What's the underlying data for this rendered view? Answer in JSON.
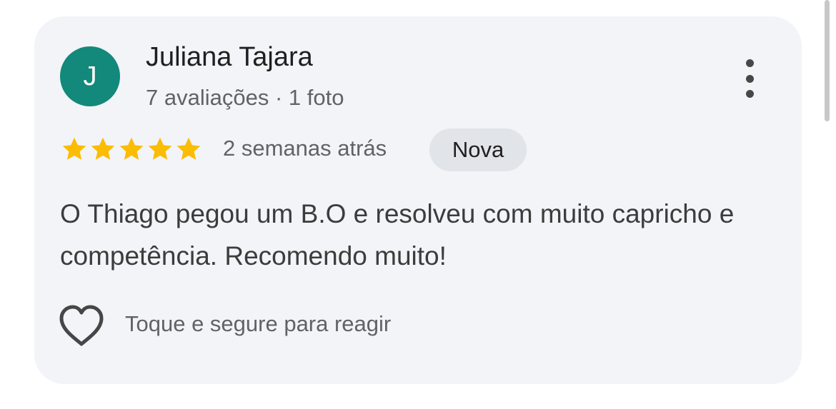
{
  "review": {
    "author_initial": "J",
    "author_name": "Juliana Tajara",
    "author_meta": "7 avaliações · 1 foto",
    "rating": 5,
    "rating_max": 5,
    "time_ago": "2 semanas atrás",
    "badge": "Nova",
    "text": "O Thiago pegou um B.O e resolveu com muito capricho e competência. Recomendo muito!",
    "react_label": "Toque e segure para reagir"
  },
  "colors": {
    "card_background": "#f3f4f7",
    "avatar": "#12897a",
    "star": "#fbbc04",
    "badge_background": "#e1e4e8"
  },
  "icons": {
    "menu": "more-vert-icon",
    "star": "star-icon",
    "heart": "heart-outline-icon"
  }
}
